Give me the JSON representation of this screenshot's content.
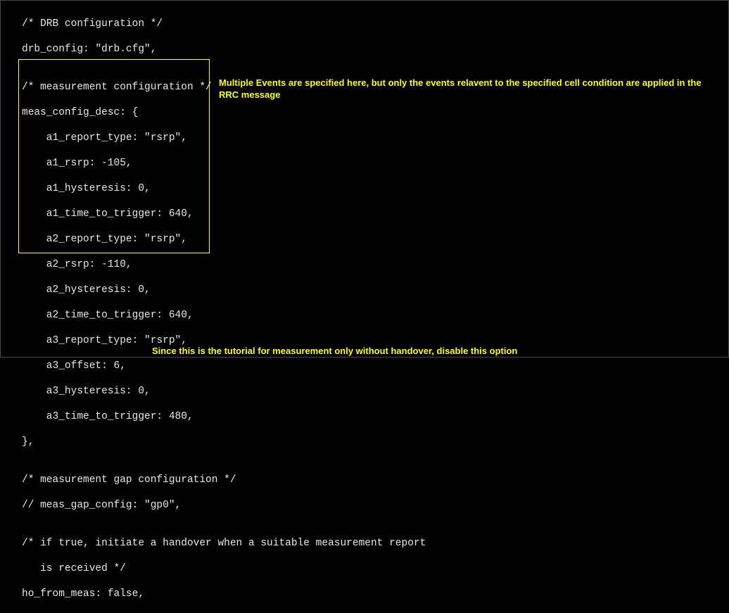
{
  "code": {
    "lines": [
      "/* DRB configuration */",
      "drb_config: \"drb.cfg\",",
      "",
      "/* measurement configuration */",
      "meas_config_desc: {",
      "    a1_report_type: \"rsrp\",",
      "    a1_rsrp: -105,",
      "    a1_hysteresis: 0,",
      "    a1_time_to_trigger: 640,",
      "    a2_report_type: \"rsrp\",",
      "    a2_rsrp: -110,",
      "    a2_hysteresis: 0,",
      "    a2_time_to_trigger: 640,",
      "    a3_report_type: \"rsrp\",",
      "    a3_offset: 6,",
      "    a3_hysteresis: 0,",
      "    a3_time_to_trigger: 480,",
      "},",
      "",
      "/* measurement gap configuration */",
      "// meas_gap_config: \"gp0\",",
      "",
      "/* if true, initiate a handover when a suitable measurement report",
      "   is received */",
      "ho_from_meas: false,"
    ]
  },
  "annotations": {
    "meas_config": "Multiple Events are specified here, but only the events relavent to the specified cell condition are applied in the RRC message",
    "ho_from_meas": "Since this is the tutorial for measurement only without handover, disable this option"
  }
}
